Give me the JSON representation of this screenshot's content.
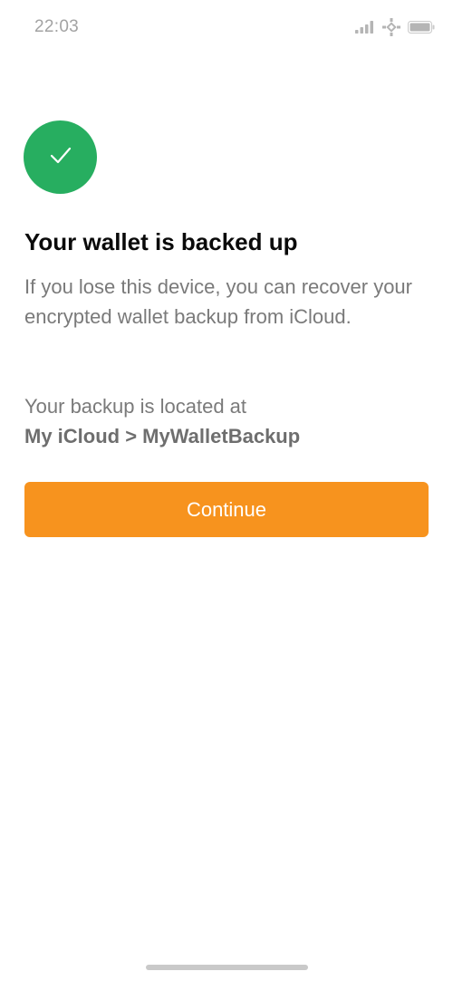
{
  "status_bar": {
    "time": "22:03",
    "icons": [
      "signal-icon",
      "network-icon",
      "battery-icon"
    ],
    "color": "#a3a3a3"
  },
  "success_icon": {
    "name": "checkmark-icon",
    "color": "#27ae60"
  },
  "content": {
    "title": "Your wallet is backed up",
    "description": "If you lose this device, you can recover your encrypted wallet backup from iCloud.",
    "location_label": "Your backup is located at",
    "location_path": "My iCloud > MyWalletBackup"
  },
  "actions": {
    "continue_label": "Continue",
    "continue_color": "#f7931e"
  }
}
